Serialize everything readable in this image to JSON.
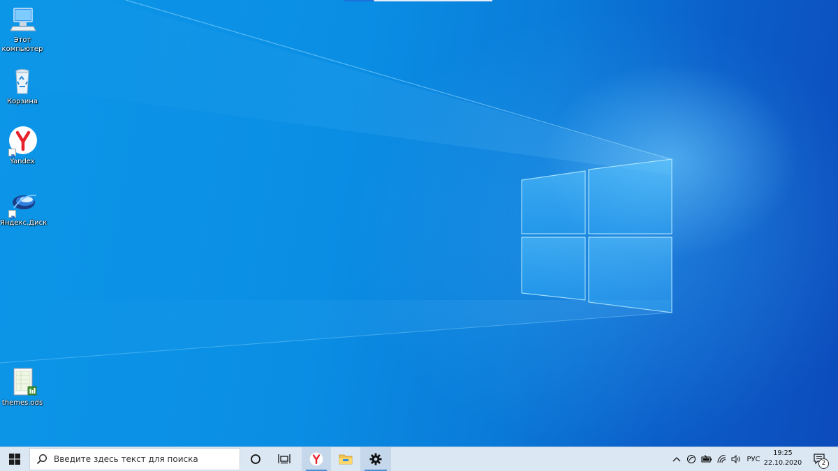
{
  "desktop": {
    "icons": [
      {
        "label_line1": "Этот",
        "label_line2": "компьютер",
        "icon": "this-pc-icon"
      },
      {
        "label": "Корзина",
        "icon": "recycle-bin-icon"
      },
      {
        "label": "Yandex",
        "icon": "yandex-browser-icon"
      },
      {
        "label": "Яндекс.Диск",
        "icon": "yandex-disk-icon"
      },
      {
        "label": "themes.ods",
        "icon": "spreadsheet-file-icon"
      }
    ]
  },
  "taskbar": {
    "search_placeholder": "Введите здесь текст для поиска",
    "pinned": [
      "cortana-icon",
      "task-view-icon",
      "yandex-browser-icon",
      "file-explorer-icon",
      "settings-gear-icon"
    ],
    "tray": {
      "language": "РУС",
      "time": "19:25",
      "date": "22.10.2020",
      "notification_count": "2"
    }
  },
  "colors": {
    "accent": "#0a7bd8",
    "taskbar": "#dbe7f3"
  }
}
